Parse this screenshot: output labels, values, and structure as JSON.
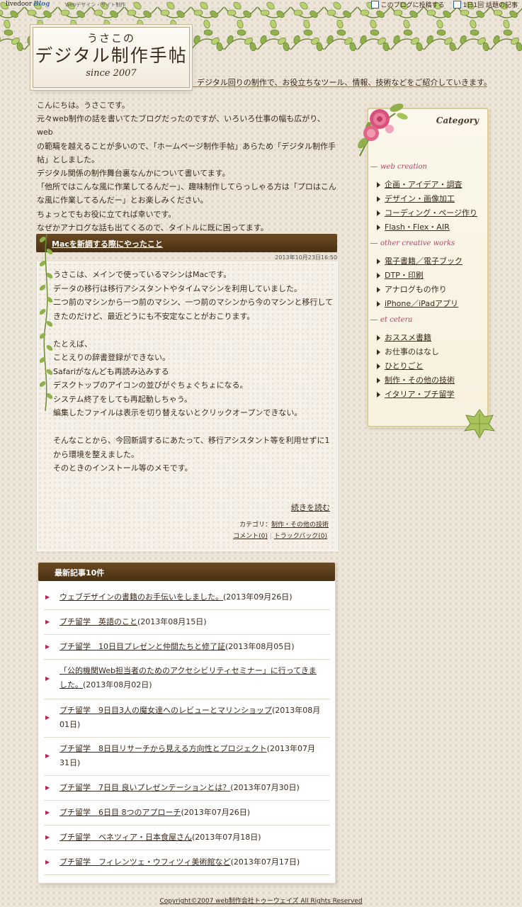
{
  "topbar": {
    "brand": "livedoor",
    "brand_suffix": "Blog",
    "site_link": "Webデザイン・サイト制作",
    "link1": "このブログに投稿する",
    "link2": "1日1回 話題の記事"
  },
  "header": {
    "title_line1": "うさこの",
    "title_line2": "デジタル制作手帖",
    "title_line3": "since 2007",
    "tagline": "デジタル回りの制作で、お役立ちなツール、情報、技術などをご紹介していきます。"
  },
  "intro": {
    "lines": [
      "こんにちは。うさこです。",
      "元々web制作の話を書いてたブログだったのですが、いろいろ仕事の幅も広がり、web",
      "の範疇を越えることが多いので、「ホームページ制作手帖」あらため「デジタル制作手",
      "帖」としました。",
      "デジタル関係の制作舞台裏なんかについて書いてます。",
      "「他所ではこんな風に作業してるんだー」、趣味制作してらっしゃる方は「プロはこん",
      "な風に作業してるんだー」とお楽しみください。",
      "ちょっとでもお役に立てれば幸いです。",
      "なぜかアナログな話も出てくるので、タイトルに既に困ってます。"
    ]
  },
  "article": {
    "title": "Macを新調する際にやったこと",
    "date": "2013年10月23日16:50",
    "lines": [
      "うさこは、メインで使っているマシンはMacです。",
      "データの移行は移行アシスタントやタイムマシンを利用していました。",
      "二つ前のマシンから一つ前のマシン、一つ前のマシンから今のマシンと移行して",
      "きたのだけど、最近どうにも不安定なことがおこります。",
      "",
      "たとえば、",
      "ことえりの辞書登録ができない。",
      "Safariがなんども再読み込みする",
      "デスクトップのアイコンの並びがぐちょぐちょになる。",
      "システム終了をしても再起動しちゃう。",
      "編集したファイルは表示を切り替えないとクリックオープンできない。",
      "",
      "そんなことから、今回新調するにあたって、移行アシスタント等を利用せずに1",
      "から環境を整えました。",
      "そのときのインストール等のメモです。"
    ],
    "read_more": "続きを読む",
    "category_label": "カテゴリ：",
    "category": "制作・その他の技術",
    "comments": "コメント(0)",
    "separator": "|",
    "trackback": "トラックバック(0)"
  },
  "recent": {
    "title": "最新記事10件",
    "items": [
      {
        "link": "ウェブデザインの書籍のお手伝いをしました。",
        "date": "(2013年09月26日)"
      },
      {
        "link": "プチ留学　英語のこと",
        "date": "(2013年08月15日)"
      },
      {
        "link": "プチ留学　10日目プレゼンと仲間たちと修了証",
        "date": "(2013年08月05日)"
      },
      {
        "link": "「公的機関Web担当者のためのアクセシビリティセミナー」に行ってきました。",
        "date": "(2013年08月02日)"
      },
      {
        "link": "プチ留学　9日目3人の魔女達へのレビューとマリンショップ",
        "date": "(2013年08月01日)"
      },
      {
        "link": "プチ留学　8日目リサーチから見える方向性とプロジェクト",
        "date": "(2013年07月31日)"
      },
      {
        "link": "プチ留学　7日目 良いプレゼンテーションとは？",
        "date": "(2013年07月30日)"
      },
      {
        "link": "プチ留学　6日目 8つのアプローチ",
        "date": "(2013年07月26日)"
      },
      {
        "link": "プチ留学　ベネツィア・日本食屋さん",
        "date": "(2013年07月18日)"
      },
      {
        "link": "プチ留学　フィレンツェ・ウフィツィ美術館など",
        "date": "(2013年07月17日)"
      }
    ]
  },
  "sidebar": {
    "title": "Category",
    "sections": [
      {
        "heading": "web creation",
        "items": [
          {
            "label": "企画・アイデア・調査",
            "link": true
          },
          {
            "label": "デザイン・画像加工",
            "link": true
          },
          {
            "label": "コーディング・ページ作り",
            "link": true
          },
          {
            "label": "Flash・Flex・AIR",
            "link": true
          }
        ]
      },
      {
        "heading": "other creative works",
        "items": [
          {
            "label": "電子書籍／電子ブック",
            "link": true
          },
          {
            "label": "DTP・印刷",
            "link": true
          },
          {
            "label": "アナログもの作り",
            "link": false
          },
          {
            "label": "iPhone／iPadアプリ",
            "link": true
          }
        ]
      },
      {
        "heading": "et cetera",
        "items": [
          {
            "label": "おススメ書籍",
            "link": true
          },
          {
            "label": "お仕事のはなし",
            "link": false
          },
          {
            "label": "ひとりごと",
            "link": true
          },
          {
            "label": "制作・その他の技術",
            "link": true
          },
          {
            "label": "イタリア・プチ留学",
            "link": true
          }
        ]
      }
    ]
  },
  "footer": {
    "copyright": "Copyright©2007 web制作会社トゥーウェイズ All Rights Reserved"
  },
  "colors": {
    "heading_bar": "#5a3c1a",
    "accent": "#b04466",
    "background": "#ece4d7"
  }
}
